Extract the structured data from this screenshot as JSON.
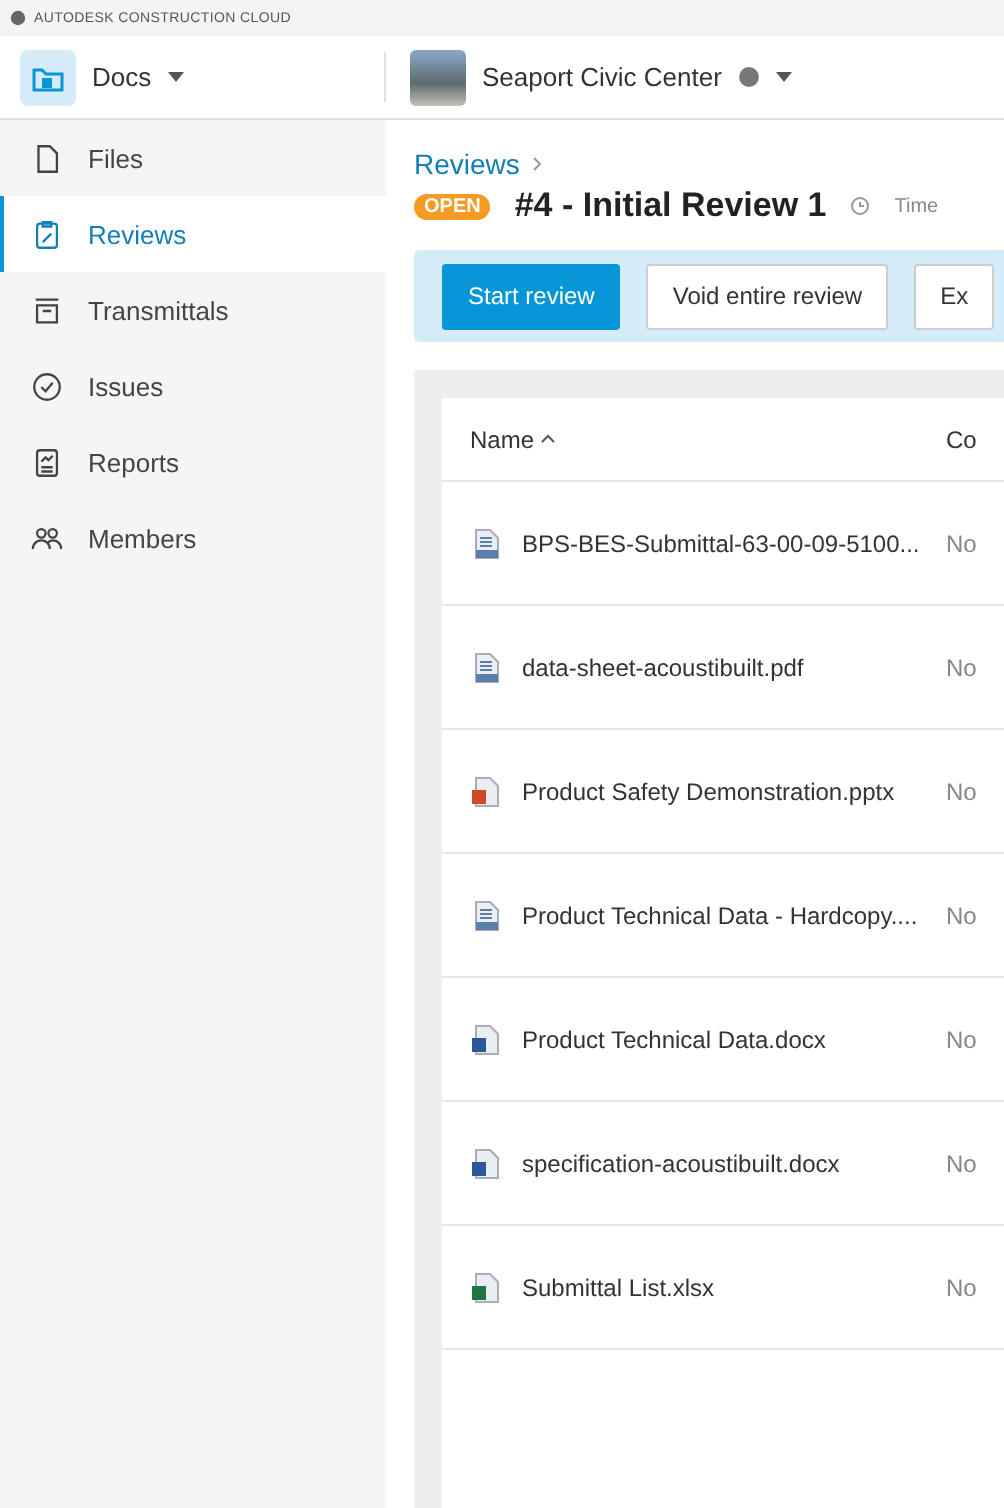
{
  "brand": "AUTODESK CONSTRUCTION CLOUD",
  "module": {
    "label": "Docs"
  },
  "project": {
    "name": "Seaport Civic Center"
  },
  "sidebar": {
    "items": [
      {
        "label": "Files",
        "selected": false
      },
      {
        "label": "Reviews",
        "selected": true
      },
      {
        "label": "Transmittals",
        "selected": false
      },
      {
        "label": "Issues",
        "selected": false
      },
      {
        "label": "Reports",
        "selected": false
      },
      {
        "label": "Members",
        "selected": false
      }
    ]
  },
  "breadcrumb": "Reviews",
  "review": {
    "status": "OPEN",
    "title": "#4 - Initial Review 1",
    "meta": "Time"
  },
  "actions": [
    {
      "label": "Start review",
      "kind": "primary"
    },
    {
      "label": "Void entire review",
      "kind": "secondary"
    },
    {
      "label": "Ex",
      "kind": "secondary"
    }
  ],
  "table": {
    "columns": [
      "Name",
      "Co"
    ],
    "rows": [
      {
        "name": "BPS-BES-Submittal-63-00-09-5100...",
        "kind": "pdf",
        "column_2": "No"
      },
      {
        "name": "data-sheet-acoustibuilt.pdf",
        "kind": "pdf",
        "column_2": "No"
      },
      {
        "name": "Product Safety Demonstration.pptx",
        "kind": "slides",
        "column_2": "No"
      },
      {
        "name": "Product Technical Data - Hardcopy....",
        "kind": "pdf",
        "column_2": "No"
      },
      {
        "name": "Product Technical Data.docx",
        "kind": "word",
        "column_2": "No"
      },
      {
        "name": "specification-acoustibuilt.docx",
        "kind": "word",
        "column_2": "No"
      },
      {
        "name": "Submittal List.xlsx",
        "kind": "sheet",
        "column_2": "No"
      }
    ]
  }
}
